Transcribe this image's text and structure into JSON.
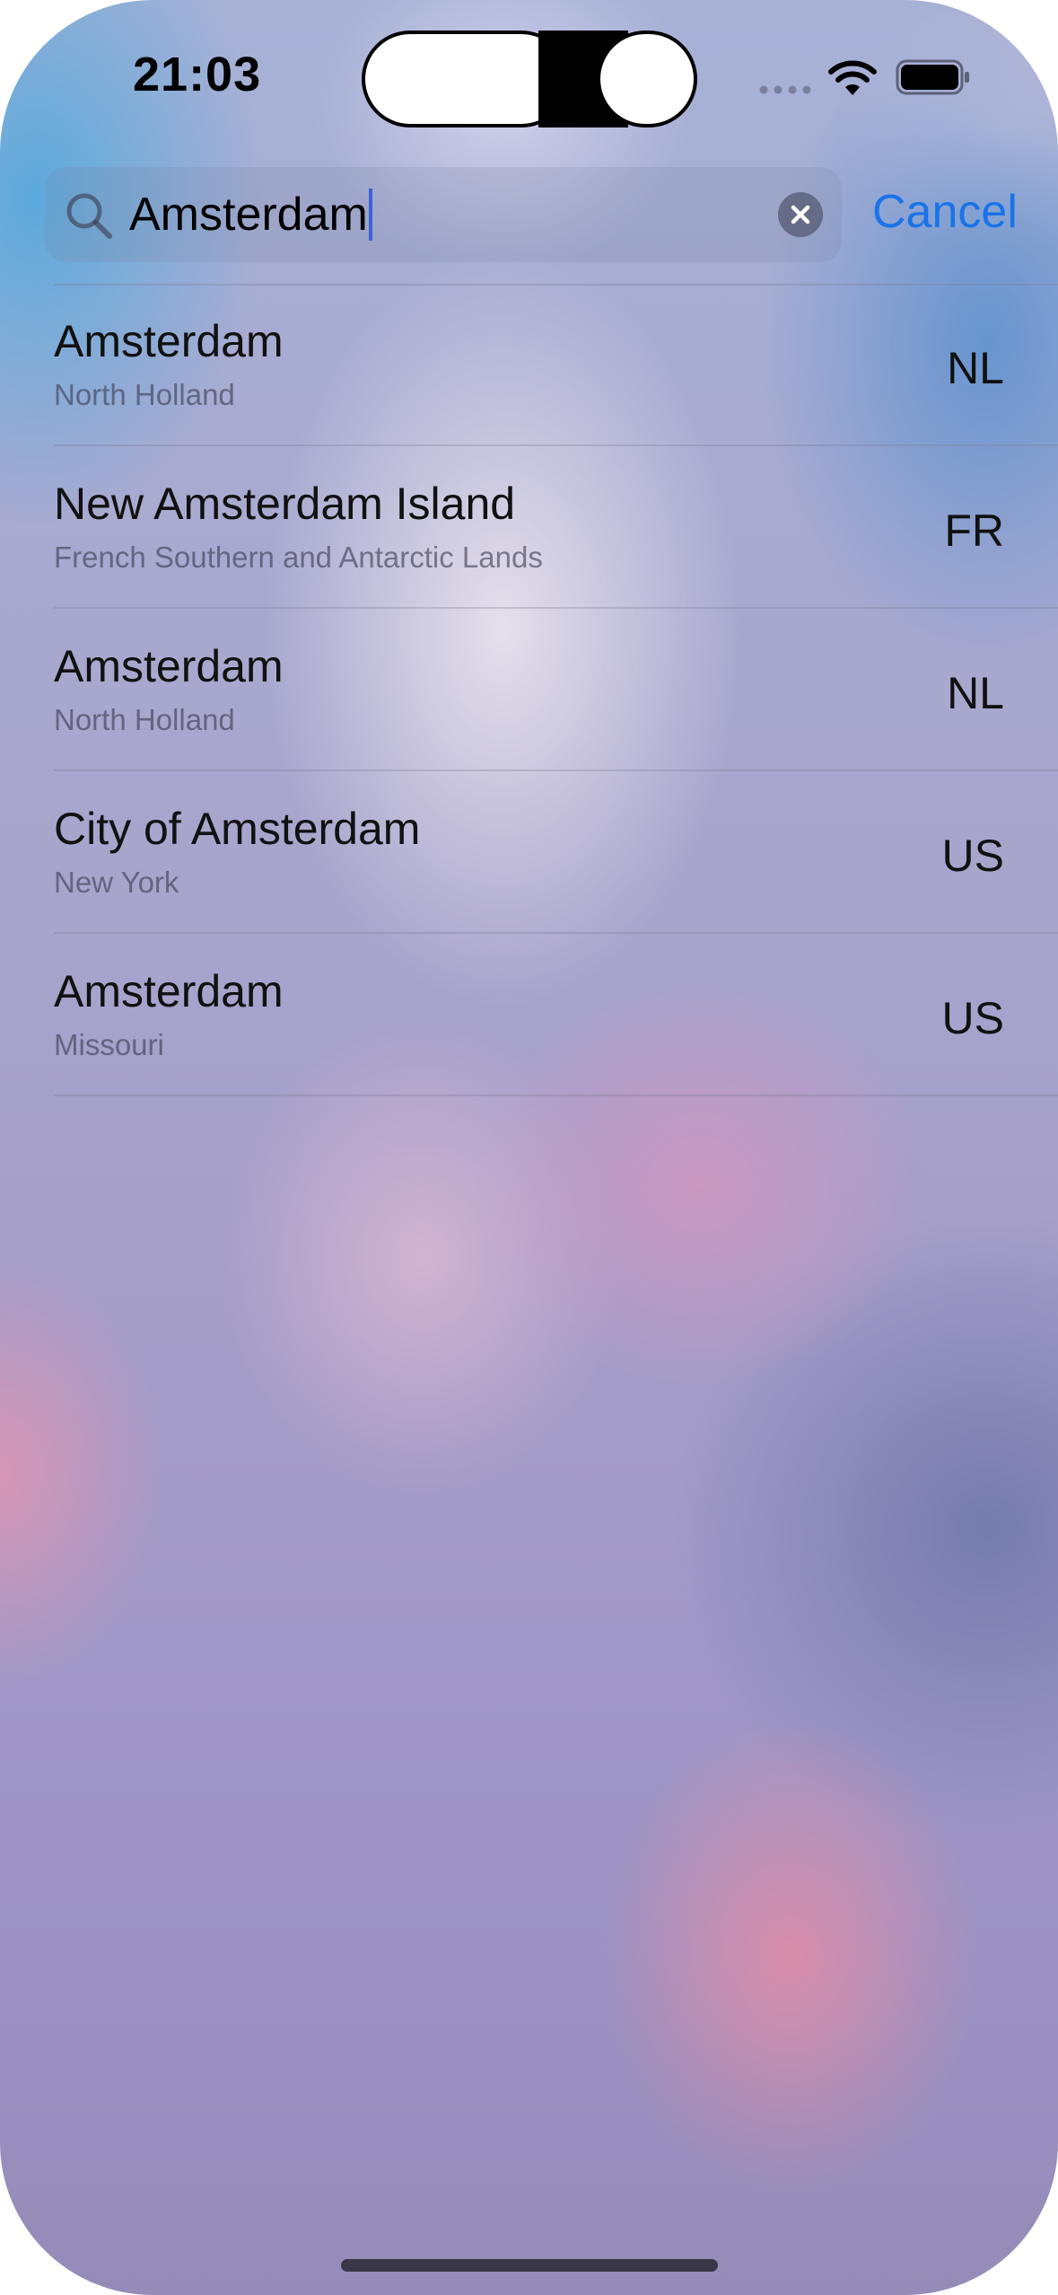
{
  "status_bar": {
    "time": "21:03"
  },
  "search": {
    "query": "Amsterdam",
    "cancel_label": "Cancel"
  },
  "results": [
    {
      "title": "Amsterdam",
      "subtitle": "North Holland",
      "country": "NL"
    },
    {
      "title": "New Amsterdam Island",
      "subtitle": "French Southern and Antarctic Lands",
      "country": "FR"
    },
    {
      "title": "Amsterdam",
      "subtitle": "North Holland",
      "country": "NL"
    },
    {
      "title": "City of Amsterdam",
      "subtitle": "New York",
      "country": "US"
    },
    {
      "title": "Amsterdam",
      "subtitle": "Missouri",
      "country": "US"
    }
  ],
  "colors": {
    "accent": "#1a73e8",
    "caret": "#3a63d8"
  },
  "icons": [
    "search-icon",
    "clear-icon",
    "wifi-icon",
    "battery-icon",
    "cellular-signal-icon"
  ]
}
